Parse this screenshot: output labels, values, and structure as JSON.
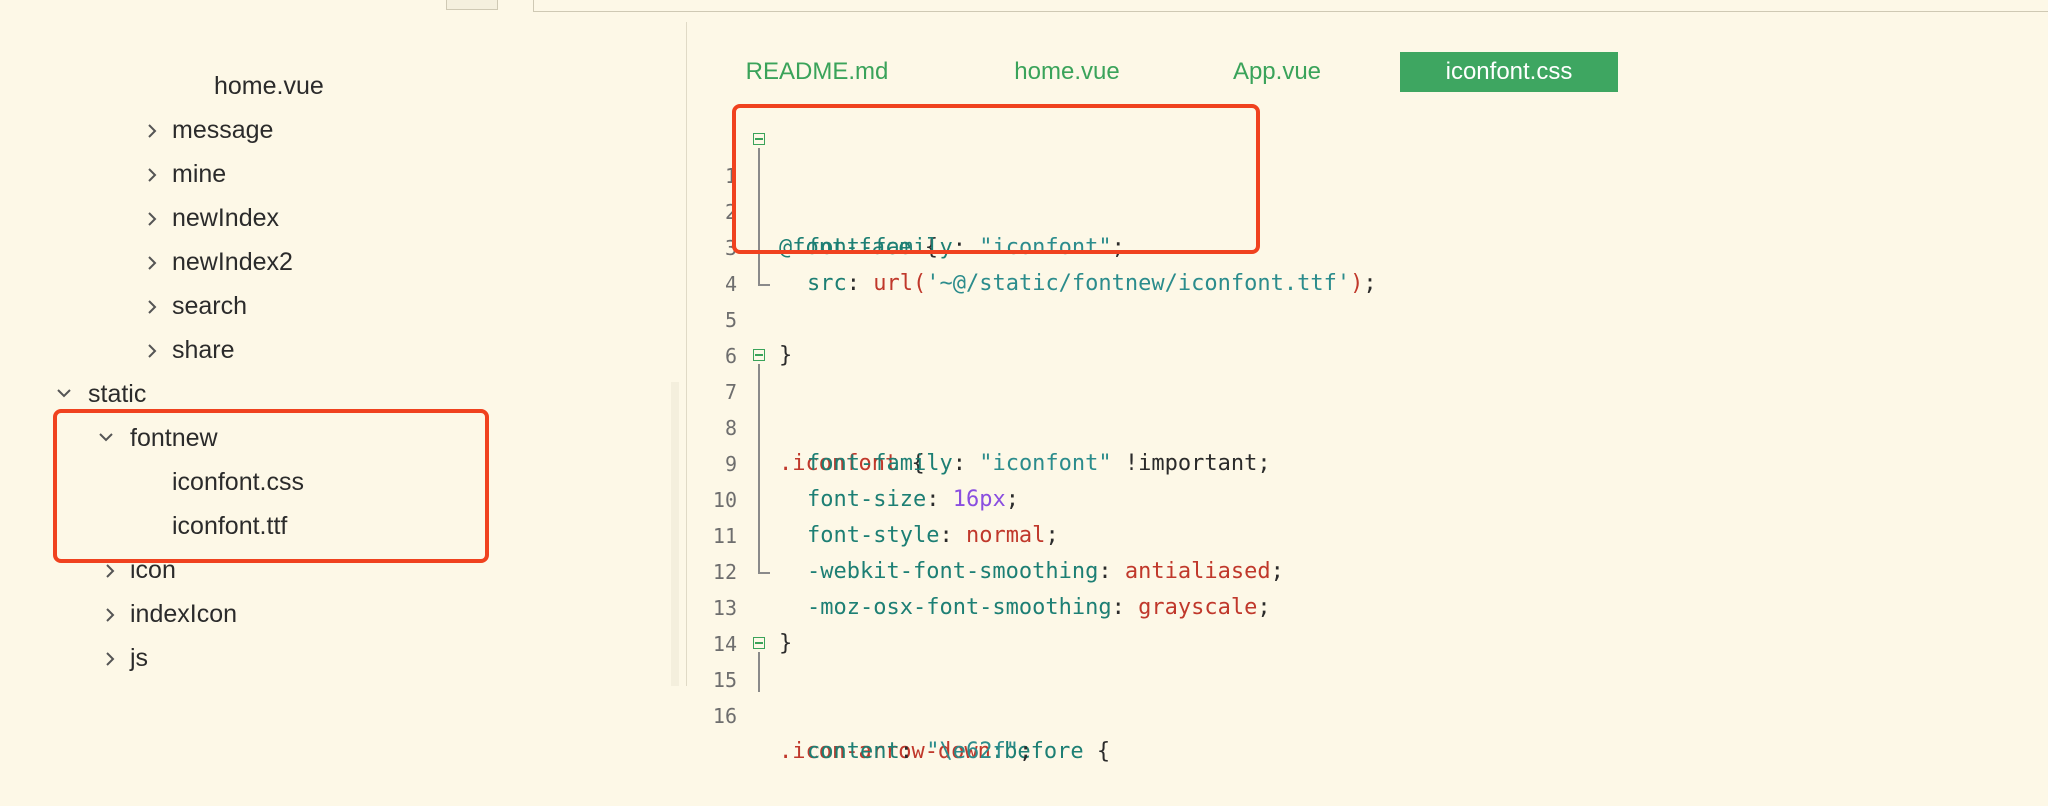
{
  "sidebar": {
    "items": [
      {
        "label": "home.vue",
        "type": "file",
        "depth": 4
      },
      {
        "label": "message",
        "type": "folder",
        "expanded": false,
        "depth": 3
      },
      {
        "label": "mine",
        "type": "folder",
        "expanded": false,
        "depth": 3
      },
      {
        "label": "newIndex",
        "type": "folder",
        "expanded": false,
        "depth": 3
      },
      {
        "label": "newIndex2",
        "type": "folder",
        "expanded": false,
        "depth": 3
      },
      {
        "label": "search",
        "type": "folder",
        "expanded": false,
        "depth": 3
      },
      {
        "label": "share",
        "type": "folder",
        "expanded": false,
        "depth": 3
      },
      {
        "label": "static",
        "type": "folder",
        "expanded": true,
        "depth": 1
      },
      {
        "label": "fontnew",
        "type": "folder",
        "expanded": true,
        "depth": 2
      },
      {
        "label": "iconfont.css",
        "type": "file",
        "depth": 3
      },
      {
        "label": "iconfont.ttf",
        "type": "file",
        "depth": 3
      },
      {
        "label": "icon",
        "type": "folder",
        "expanded": false,
        "depth": 2
      },
      {
        "label": "indexIcon",
        "type": "folder",
        "expanded": false,
        "depth": 2
      },
      {
        "label": "js",
        "type": "folder",
        "expanded": false,
        "depth": 2
      }
    ]
  },
  "tabs": [
    {
      "label": "README.md",
      "active": false
    },
    {
      "label": "home.vue",
      "active": false
    },
    {
      "label": "App.vue",
      "active": false
    },
    {
      "label": "iconfont.css",
      "active": true
    }
  ],
  "code": {
    "line_numbers": [
      "1",
      "2",
      "3",
      "4",
      "5",
      "6",
      "7",
      "8",
      "9",
      "10",
      "11",
      "12",
      "13",
      "14",
      "15",
      "16"
    ],
    "l1": {
      "sel": "@font-face",
      "brace": " {"
    },
    "l2": {
      "prop": "font-family",
      "colon": ": ",
      "str": "\"iconfont\"",
      "end": ";"
    },
    "l3": {
      "prop": "src",
      "colon": ": ",
      "fn": "url(",
      "str": "'~@/static/fontnew/iconfont.ttf'",
      "fnclose": ")",
      "end": ";"
    },
    "l5": {
      "brace": "}"
    },
    "l7": {
      "sel": ".iconfont",
      "brace": " {"
    },
    "l8": {
      "prop": "font-family",
      "colon": ": ",
      "str": "\"iconfont\"",
      "imp": " !important",
      "end": ";"
    },
    "l9": {
      "prop": "font-size",
      "colon": ": ",
      "num": "16px",
      "end": ";"
    },
    "l10": {
      "prop": "font-style",
      "colon": ": ",
      "val": "normal",
      "end": ";"
    },
    "l11": {
      "prop": "-webkit-font-smoothing",
      "colon": ": ",
      "val": "antialiased",
      "end": ";"
    },
    "l12": {
      "prop": "-moz-osx-font-smoothing",
      "colon": ": ",
      "val": "grayscale",
      "end": ";"
    },
    "l13": {
      "brace": "}"
    },
    "l15": {
      "sel": ".icon-arrow-down",
      "pseudo": ":before",
      "brace": " {"
    },
    "l16": {
      "prop": "content",
      "colon": ": ",
      "str": "\"\\e62f\"",
      "end": ";"
    }
  },
  "colors": {
    "background": "#fdf8e7",
    "accent_green": "#3ea661",
    "highlight_red": "#f0421f"
  }
}
